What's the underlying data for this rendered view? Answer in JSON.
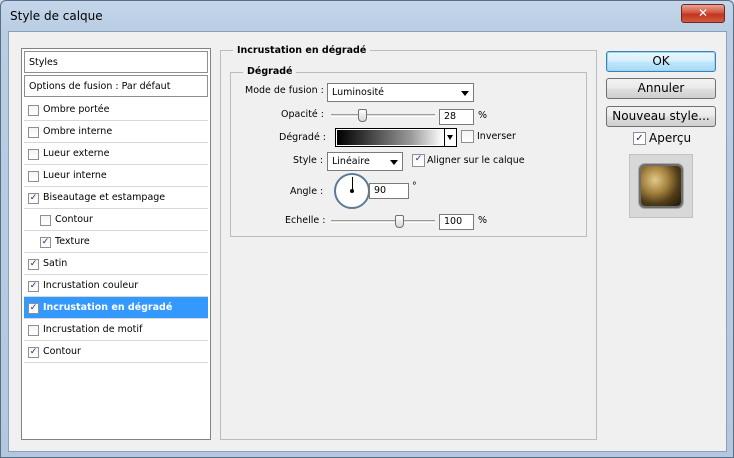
{
  "window": {
    "title": "Style de calque",
    "close_glyph": "✕"
  },
  "styles_list": {
    "header": "Styles",
    "blending_options": "Options de fusion : Par défaut",
    "items": [
      {
        "label": "Ombre portée",
        "checked": false,
        "indent": false,
        "selected": false
      },
      {
        "label": "Ombre interne",
        "checked": false,
        "indent": false,
        "selected": false
      },
      {
        "label": "Lueur externe",
        "checked": false,
        "indent": false,
        "selected": false
      },
      {
        "label": "Lueur interne",
        "checked": false,
        "indent": false,
        "selected": false
      },
      {
        "label": "Biseautage et estampage",
        "checked": true,
        "indent": false,
        "selected": false
      },
      {
        "label": "Contour",
        "checked": false,
        "indent": true,
        "selected": false
      },
      {
        "label": "Texture",
        "checked": true,
        "indent": true,
        "selected": false
      },
      {
        "label": "Satin",
        "checked": true,
        "indent": false,
        "selected": false
      },
      {
        "label": "Incrustation couleur",
        "checked": true,
        "indent": false,
        "selected": false
      },
      {
        "label": "Incrustation en dégradé",
        "checked": true,
        "indent": false,
        "selected": true
      },
      {
        "label": "Incrustation de motif",
        "checked": false,
        "indent": false,
        "selected": false
      },
      {
        "label": "Contour",
        "checked": true,
        "indent": false,
        "selected": false
      }
    ]
  },
  "panel": {
    "group_title": "Incrustation en dégradé",
    "subgroup_title": "Dégradé",
    "blend_mode_label": "Mode de fusion :",
    "blend_mode_value": "Luminosité",
    "opacity_label": "Opacité :",
    "opacity_value": "28",
    "opacity_fraction": 0.28,
    "percent": "%",
    "gradient_label": "Dégradé :",
    "reverse_label": "Inverser",
    "reverse_checked": false,
    "style_label": "Style :",
    "style_value": "Linéaire",
    "align_label": "Aligner sur le calque",
    "align_checked": true,
    "angle_label": "Angle :",
    "angle_value": "90",
    "degree": "°",
    "scale_label": "Echelle :",
    "scale_value": "100",
    "scale_fraction": 0.67
  },
  "buttons": {
    "ok": "OK",
    "cancel": "Annuler",
    "new_style": "Nouveau style...",
    "preview_label": "Aperçu",
    "preview_checked": true
  },
  "colors": {
    "selection": "#3399ff",
    "checkmark": "#1a2e6e"
  }
}
